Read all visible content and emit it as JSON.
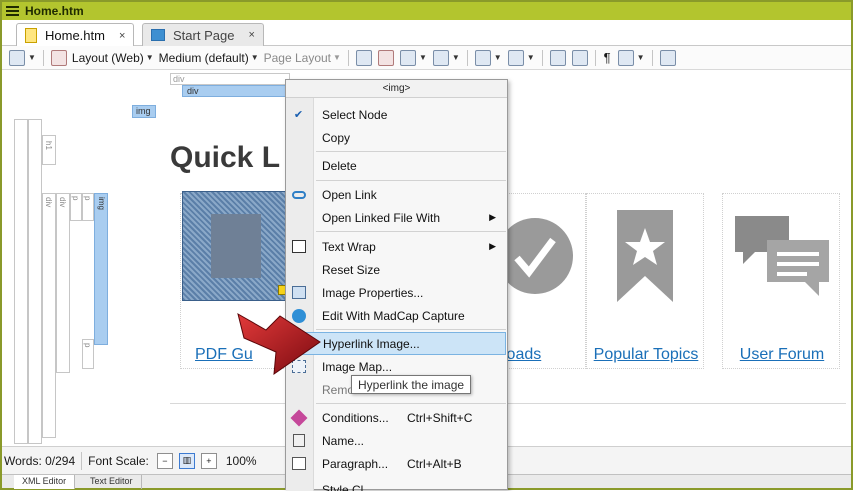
{
  "window": {
    "title": "Home.htm"
  },
  "tabs": [
    {
      "label": "Home.htm",
      "close": "×"
    },
    {
      "label": "Start Page",
      "close": "×"
    }
  ],
  "toolbar": {
    "layout_label": "Layout (Web)",
    "medium_label": "Medium (default)",
    "page_layout_label": "Page Layout",
    "pilcrow": "¶"
  },
  "editor": {
    "div_tag": "div",
    "div_tag_selected": "div",
    "img_tag": "img",
    "struct_tags": [
      "h1",
      "div",
      "div",
      "p",
      "p",
      "img",
      "p"
    ],
    "page_title": "Quick L",
    "cards": [
      {
        "label": "PDF Gu"
      },
      {
        "label": "loads"
      },
      {
        "label": "Popular Topics"
      },
      {
        "label": "User Forum"
      }
    ]
  },
  "context_menu": {
    "header": "<img>",
    "items": [
      {
        "label": "Select Node",
        "icon": "check-icon"
      },
      {
        "label": "Copy"
      },
      {
        "label": "Delete"
      },
      {
        "label": "Open Link",
        "icon": "link-icon"
      },
      {
        "label": "Open Linked File With",
        "submenu": "▶"
      },
      {
        "label": "Text Wrap",
        "icon": "text-wrap-icon",
        "submenu": "▶"
      },
      {
        "label": "Reset Size"
      },
      {
        "label": "Image Properties...",
        "icon": "image-properties-icon"
      },
      {
        "label": "Edit With MadCap Capture",
        "icon": "capture-icon"
      },
      {
        "label": "Hyperlink Image...",
        "icon": "hyperlink-image-icon"
      },
      {
        "label": "Image Map...",
        "icon": "image-map-icon"
      },
      {
        "label": "Remo"
      },
      {
        "label": "Conditions...",
        "shortcut": "Ctrl+Shift+C",
        "icon": "conditions-icon"
      },
      {
        "label": "Name...",
        "icon": "name-icon"
      },
      {
        "label": "Paragraph...",
        "shortcut": "Ctrl+Alt+B",
        "icon": "paragraph-icon"
      },
      {
        "label": "Style Cl"
      }
    ],
    "tooltip": "Hyperlink the image"
  },
  "status": {
    "words": "Words: 0/294",
    "font_scale_label": "Font Scale:",
    "zoom": "100%"
  },
  "bottom_tabs": [
    "XML Editor",
    "Text Editor"
  ],
  "colors": {
    "title_bar": "#b3c52e",
    "highlight": "#cce4f7",
    "link": "#1a6fb8",
    "selection": "#a9cdf0",
    "arrow": "#b3121a"
  }
}
